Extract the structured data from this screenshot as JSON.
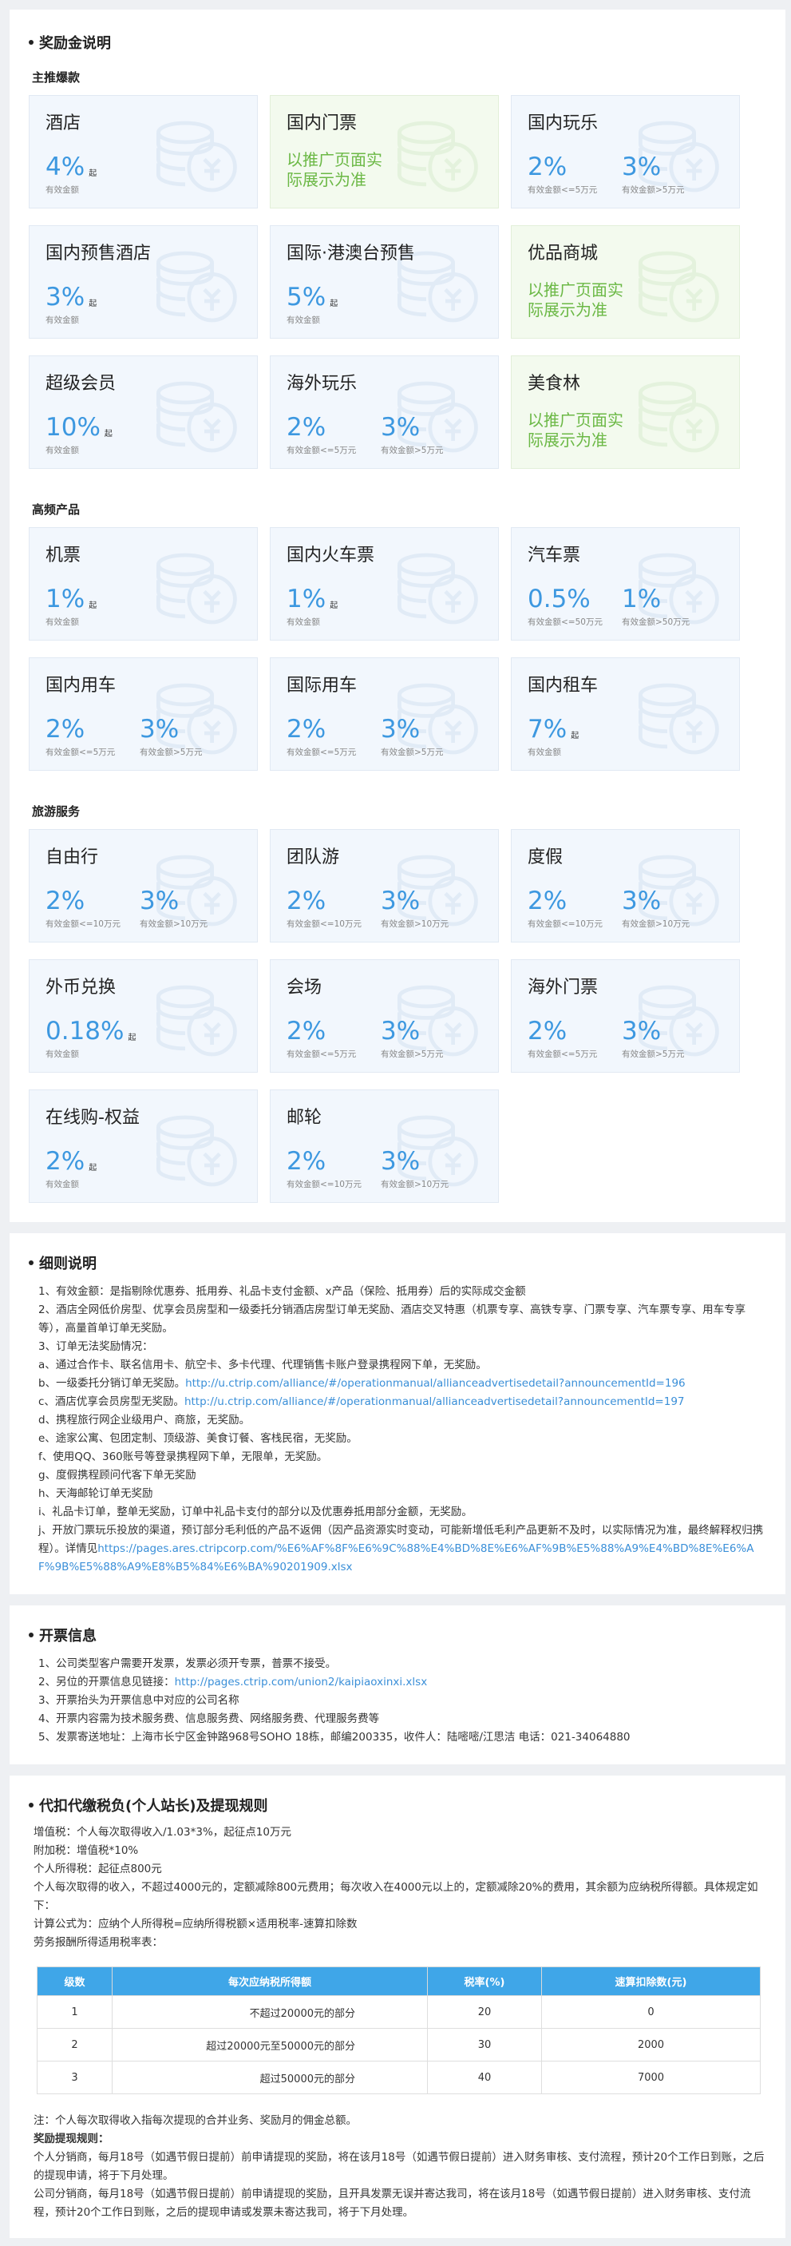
{
  "reward": {
    "title": "奖励金说明",
    "sections": [
      {
        "name": "主推爆款",
        "cards": [
          {
            "name": "酒店",
            "rates": [
              {
                "value": "4%",
                "suffix": "起",
                "note": "有效金额"
              }
            ]
          },
          {
            "name": "国内门票",
            "promo": "以推广页面实际展示为准"
          },
          {
            "name": "国内玩乐",
            "rates": [
              {
                "value": "2%",
                "note": "有效金额<=5万元"
              },
              {
                "value": "3%",
                "note": "有效金额>5万元"
              }
            ]
          },
          {
            "name": "国内预售酒店",
            "rates": [
              {
                "value": "3%",
                "suffix": "起",
                "note": "有效金额"
              }
            ]
          },
          {
            "name": "国际·港澳台预售",
            "rates": [
              {
                "value": "5%",
                "suffix": "起",
                "note": "有效金额"
              }
            ]
          },
          {
            "name": "优品商城",
            "promo": "以推广页面实际展示为准"
          },
          {
            "name": "超级会员",
            "rates": [
              {
                "value": "10%",
                "suffix": "起",
                "note": "有效金额"
              }
            ]
          },
          {
            "name": "海外玩乐",
            "rates": [
              {
                "value": "2%",
                "note": "有效金额<=5万元"
              },
              {
                "value": "3%",
                "note": "有效金额>5万元"
              }
            ]
          },
          {
            "name": "美食林",
            "promo": "以推广页面实际展示为准"
          }
        ]
      },
      {
        "name": "高频产品",
        "cards": [
          {
            "name": "机票",
            "rates": [
              {
                "value": "1%",
                "suffix": "起",
                "note": "有效金额"
              }
            ]
          },
          {
            "name": "国内火车票",
            "rates": [
              {
                "value": "1%",
                "suffix": "起",
                "note": "有效金额"
              }
            ]
          },
          {
            "name": "汽车票",
            "rates": [
              {
                "value": "0.5%",
                "note": "有效金额<=50万元"
              },
              {
                "value": "1%",
                "note": "有效金额>50万元"
              }
            ]
          },
          {
            "name": "国内用车",
            "rates": [
              {
                "value": "2%",
                "note": "有效金额<=5万元"
              },
              {
                "value": "3%",
                "note": "有效金额>5万元"
              }
            ]
          },
          {
            "name": "国际用车",
            "rates": [
              {
                "value": "2%",
                "note": "有效金额<=5万元"
              },
              {
                "value": "3%",
                "note": "有效金额>5万元"
              }
            ]
          },
          {
            "name": "国内租车",
            "rates": [
              {
                "value": "7%",
                "suffix": "起",
                "note": "有效金额"
              }
            ]
          }
        ]
      },
      {
        "name": "旅游服务",
        "cards": [
          {
            "name": "自由行",
            "rates": [
              {
                "value": "2%",
                "note": "有效金额<=10万元"
              },
              {
                "value": "3%",
                "note": "有效金额>10万元"
              }
            ]
          },
          {
            "name": "团队游",
            "rates": [
              {
                "value": "2%",
                "note": "有效金额<=10万元"
              },
              {
                "value": "3%",
                "note": "有效金额>10万元"
              }
            ]
          },
          {
            "name": "度假",
            "rates": [
              {
                "value": "2%",
                "note": "有效金额<=10万元"
              },
              {
                "value": "3%",
                "note": "有效金额>10万元"
              }
            ]
          },
          {
            "name": "外币兑换",
            "rates": [
              {
                "value": "0.18%",
                "suffix": "起",
                "note": "有效金额"
              }
            ]
          },
          {
            "name": "会场",
            "rates": [
              {
                "value": "2%",
                "note": "有效金额<=5万元"
              },
              {
                "value": "3%",
                "note": "有效金额>5万元"
              }
            ]
          },
          {
            "name": "海外门票",
            "rates": [
              {
                "value": "2%",
                "note": "有效金额<=5万元"
              },
              {
                "value": "3%",
                "note": "有效金额>5万元"
              }
            ]
          },
          {
            "name": "在线购-权益",
            "rates": [
              {
                "value": "2%",
                "suffix": "起",
                "note": "有效金额"
              }
            ]
          },
          {
            "name": "邮轮",
            "rates": [
              {
                "value": "2%",
                "note": "有效金额<=10万元"
              },
              {
                "value": "3%",
                "note": "有效金额>10万元"
              }
            ]
          }
        ]
      }
    ]
  },
  "rules": {
    "title": "细则说明",
    "lines": [
      "1、有效金额：是指剔除优惠券、抵用券、礼品卡支付金额、x产品（保险、抵用券）后的实际成交金额",
      "2、酒店全网低价房型、优享会员房型和一级委托分销酒店房型订单无奖励、酒店交叉特惠（机票专享、高铁专享、门票专享、汽车票专享、用车专享等），高量首单订单无奖励。",
      "3、订单无法奖励情况：",
      "a、通过合作卡、联名信用卡、航空卡、多卡代理、代理销售卡账户登录携程网下单，无奖励。",
      {
        "text": "b、一级委托分销订单无奖励。",
        "link": "http://u.ctrip.com/alliance/#/operationmanual/allianceadvertisedetail?announcementId=196"
      },
      {
        "text": "c、酒店优享会员房型无奖励。",
        "link": "http://u.ctrip.com/alliance/#/operationmanual/allianceadvertisedetail?announcementId=197"
      },
      "d、携程旅行网企业级用户、商旅，无奖励。",
      "e、途家公寓、包团定制、顶级游、美食订餐、客栈民宿，无奖励。",
      "f、使用QQ、360账号等登录携程网下单，无限单，无奖励。",
      "g、度假携程顾问代客下单无奖励",
      "h、天海邮轮订单无奖励",
      "i、礼品卡订单，整单无奖励，订单中礼品卡支付的部分以及优惠券抵用部分金额，无奖励。",
      {
        "text": "j、开放门票玩乐投放的渠道，预订部分毛利低的产品不返佣（因产品资源实时变动，可能新增低毛利产品更新不及时，以实际情况为准，最终解释权归携程）。详情见",
        "link": "https://pages.ares.ctripcorp.com/%E6%AF%8F%E6%9C%88%E4%BD%8E%E6%AF%9B%E5%88%A9%E4%BD%8E%E6%AF%9B%E5%88%A9%E8%B5%84%E6%BA%90201909.xlsx"
      }
    ]
  },
  "invoice": {
    "title": "开票信息",
    "lines": [
      "1、公司类型客户需要开发票，发票必须开专票，普票不接受。",
      {
        "text": "2、另位的开票信息见链接：",
        "link": "http://pages.ctrip.com/union2/kaipiaoxinxi.xlsx"
      },
      "3、开票抬头为开票信息中对应的公司名称",
      "4、开票内容需为技术服务费、信息服务费、网络服务费、代理服务费等",
      "5、发票寄送地址：上海市长宁区金钟路968号SOHO 18栋，邮编200335，收件人：陆嘧嘧/江思洁 电话：021-34064880"
    ]
  },
  "tax": {
    "title": "代扣代缴税负(个人站长)及提现规则",
    "intro_lines": [
      "增值税：个人每次取得收入/1.03*3%，起征点10万元",
      "附加税：增值税*10%",
      "个人所得税：起征点800元",
      "个人每次取得的收入，不超过4000元的，定额减除800元费用；每次收入在4000元以上的，定额减除20%的费用，其余额为应纳税所得额。具体规定如下：",
      "计算公式为：应纳个人所得税=应纳所得税额×适用税率-速算扣除数",
      "劳务报酬所得适用税率表："
    ],
    "table": {
      "headers": [
        "级数",
        "每次应纳税所得额",
        "税率(%)",
        "速算扣除数(元)"
      ],
      "rows": [
        [
          "1",
          "不超过20000元的部分",
          "20",
          "0"
        ],
        [
          "2",
          "超过20000元至50000元的部分",
          "30",
          "2000"
        ],
        [
          "3",
          "超过50000元的部分",
          "40",
          "7000"
        ]
      ]
    },
    "notes": [
      "注：个人每次取得收入指每次提现的合并业务、奖励月的佣金总额。",
      "奖励提现规则：",
      "个人分销商，每月18号（如遇节假日提前）前申请提现的奖励，将在该月18号（如遇节假日提前）进入财务审核、支付流程，预计20个工作日到账，之后的提现申请，将于下月处理。",
      "公司分销商，每月18号（如遇节假日提前）前申请提现的奖励，且开具发票无误并寄达我司，将在该月18号（如遇节假日提前）进入财务审核、支付流程，预计20个工作日到账，之后的提现申请或发票未寄达我司，将于下月处理。"
    ]
  }
}
